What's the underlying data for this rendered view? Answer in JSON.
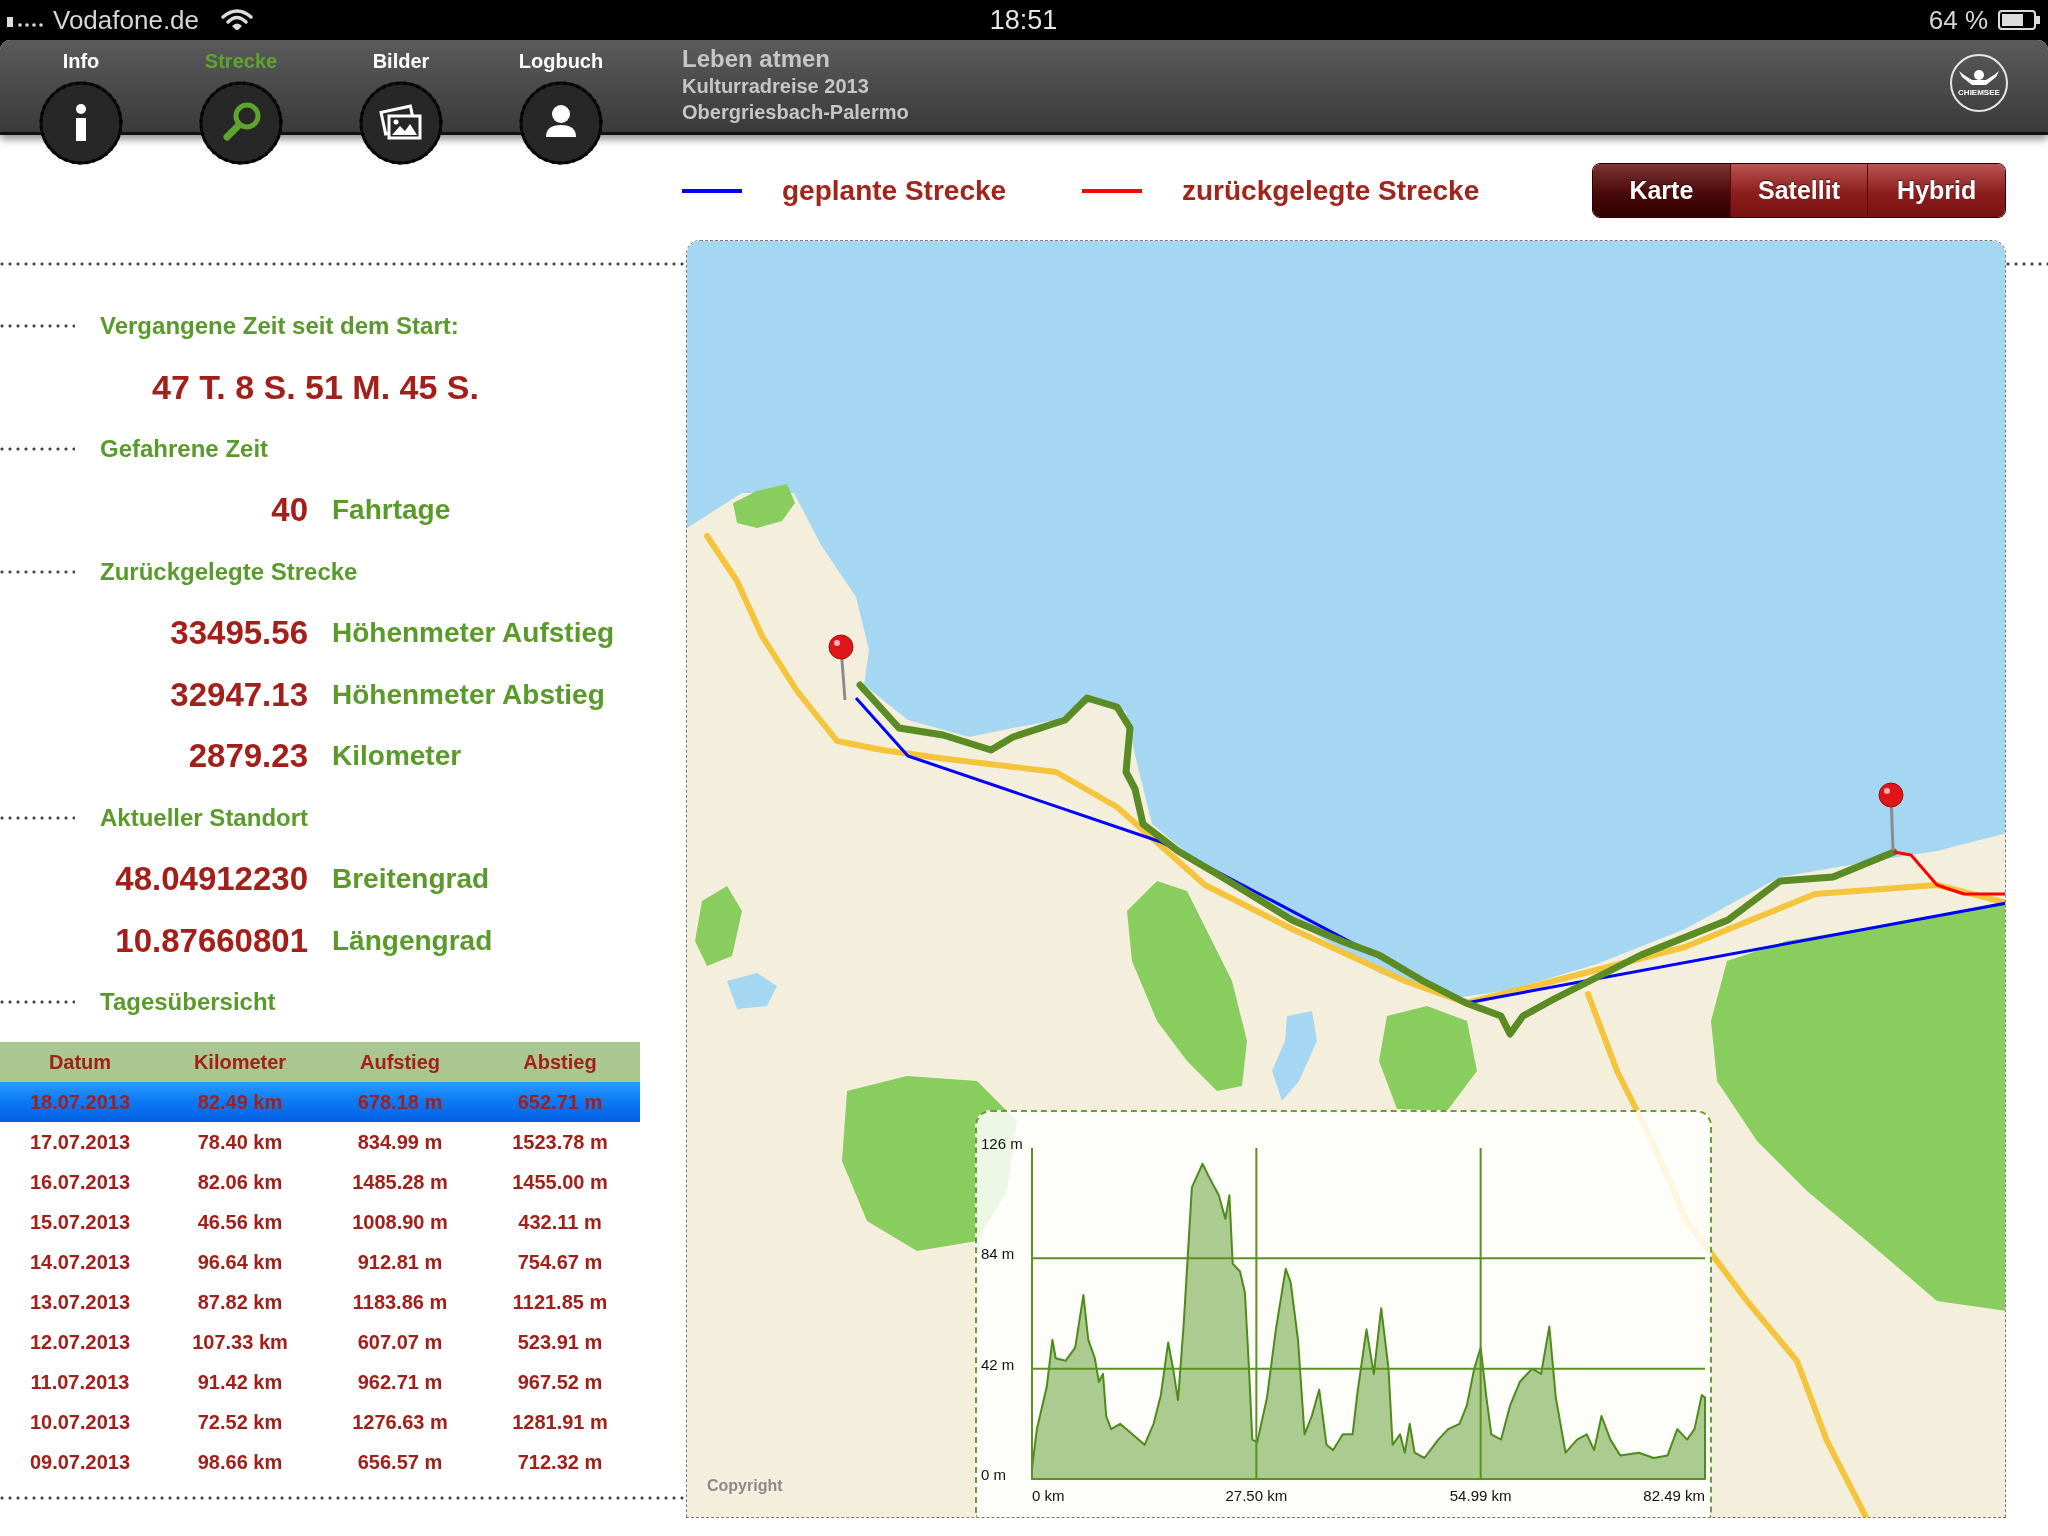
{
  "status_bar": {
    "carrier": "Vodafone.de",
    "time": "18:51",
    "battery": "64 %"
  },
  "tabs": [
    {
      "label": "Info",
      "selected": false
    },
    {
      "label": "Strecke",
      "selected": true
    },
    {
      "label": "Bilder",
      "selected": false
    },
    {
      "label": "Logbuch",
      "selected": false
    }
  ],
  "header": {
    "title": "Leben atmen",
    "subtitle": "Kulturradreise 2013",
    "route": "Obergriesbach-Palermo",
    "logo_text": "CHIEMSEE"
  },
  "legend": [
    {
      "label": "geplante Strecke",
      "color": "#0000ff"
    },
    {
      "label": "zurückgelegte Strecke",
      "color": "#ff0000"
    }
  ],
  "map_types": [
    {
      "label": "Karte",
      "selected": true
    },
    {
      "label": "Satellit",
      "selected": false
    },
    {
      "label": "Hybrid",
      "selected": false
    }
  ],
  "stats": [
    {
      "title": "Vergangene Zeit seit dem Start:",
      "rows": [
        {
          "kind": "text",
          "value": "47 T. 8 S. 51 M. 45 S."
        }
      ]
    },
    {
      "title": "Gefahrene Zeit",
      "rows": [
        {
          "kind": "pair",
          "value": "40",
          "label": "Fahrtage"
        }
      ]
    },
    {
      "title": "Zurückgelegte Strecke",
      "rows": [
        {
          "kind": "pair",
          "value": "33495.56",
          "label": "Höhenmeter Aufstieg"
        },
        {
          "kind": "pair",
          "value": "32947.13",
          "label": "Höhenmeter Abstieg"
        },
        {
          "kind": "pair",
          "value": "2879.23",
          "label": "Kilometer"
        }
      ]
    },
    {
      "title": "Aktueller Standort",
      "rows": [
        {
          "kind": "pair",
          "value": "48.04912230",
          "label": "Breitengrad"
        },
        {
          "kind": "pair",
          "value": "10.87660801",
          "label": "Längengrad"
        }
      ]
    },
    {
      "title": "Tagesübersicht"
    }
  ],
  "day_table": {
    "columns": [
      "Datum",
      "Kilometer",
      "Aufstieg",
      "Abstieg"
    ],
    "rows": [
      {
        "selected": true,
        "cells": [
          "18.07.2013",
          "82.49 km",
          "678.18 m",
          "652.71 m"
        ]
      },
      {
        "selected": false,
        "cells": [
          "17.07.2013",
          "78.40 km",
          "834.99 m",
          "1523.78 m"
        ]
      },
      {
        "selected": false,
        "cells": [
          "16.07.2013",
          "82.06 km",
          "1485.28 m",
          "1455.00 m"
        ]
      },
      {
        "selected": false,
        "cells": [
          "15.07.2013",
          "46.56 km",
          "1008.90 m",
          "432.11 m"
        ]
      },
      {
        "selected": false,
        "cells": [
          "14.07.2013",
          "96.64 km",
          "912.81 m",
          "754.67 m"
        ]
      },
      {
        "selected": false,
        "cells": [
          "13.07.2013",
          "87.82 km",
          "1183.86 m",
          "1121.85 m"
        ]
      },
      {
        "selected": false,
        "cells": [
          "12.07.2013",
          "107.33 km",
          "607.07 m",
          "523.91 m"
        ]
      },
      {
        "selected": false,
        "cells": [
          "11.07.2013",
          "91.42 km",
          "962.71 m",
          "967.52 m"
        ]
      },
      {
        "selected": false,
        "cells": [
          "10.07.2013",
          "72.52 km",
          "1276.63 m",
          "1281.91 m"
        ]
      },
      {
        "selected": false,
        "cells": [
          "09.07.2013",
          "98.66 km",
          "656.57 m",
          "712.32 m"
        ]
      }
    ]
  },
  "map": {
    "elevation_chart": {
      "chart_data": {
        "type": "area",
        "x": [
          0,
          0.6,
          1.8,
          2.5,
          2.9,
          4.1,
          5.3,
          6.3,
          6.9,
          7.7,
          8.2,
          8.7,
          9.1,
          9.7,
          10.8,
          12.3,
          13.8,
          14.9,
          15.8,
          16.7,
          17.3,
          17.9,
          18.6,
          19.6,
          20.9,
          21.7,
          22.9,
          23.7,
          24.2,
          24.6,
          25.5,
          26.1,
          26.6,
          27.0,
          27.6,
          28.8,
          29.9,
          31.1,
          31.7,
          32.6,
          33.4,
          34.3,
          35.2,
          36.1,
          36.9,
          38.1,
          39.3,
          39.9,
          41.0,
          41.9,
          42.8,
          43.7,
          44.2,
          45.1,
          45.7,
          46.3,
          46.9,
          48.1,
          49.8,
          51.0,
          52.4,
          53.3,
          54.2,
          55.0,
          55.7,
          56.3,
          57.5,
          58.6,
          59.8,
          61.3,
          62.4,
          63.4,
          64.2,
          65.4,
          66.8,
          68.0,
          68.9,
          69.8,
          70.9,
          72.1,
          74.4,
          76.2,
          77.9,
          79.1,
          80.3,
          81.2,
          82.1,
          82.49
        ],
        "values": [
          4,
          19,
          35,
          53,
          46,
          45,
          50,
          70,
          53,
          46,
          37,
          40,
          24,
          19,
          21,
          17,
          13,
          21,
          32,
          52,
          42,
          30,
          59,
          111,
          120,
          115,
          108,
          99,
          108,
          82,
          79,
          71,
          42,
          15,
          14,
          31,
          57,
          80,
          75,
          53,
          17,
          24,
          34,
          13,
          11,
          17,
          17,
          33,
          57,
          40,
          65,
          42,
          13,
          17,
          10,
          21,
          10,
          8,
          15,
          19,
          21,
          28,
          42,
          50,
          31,
          17,
          15,
          28,
          37,
          42,
          40,
          58,
          31,
          10,
          15,
          17,
          11,
          24,
          15,
          9,
          10,
          8,
          9,
          19,
          15,
          19,
          32,
          31
        ],
        "xlim": [
          0,
          82.49
        ],
        "ylim": [
          0,
          126
        ],
        "xticks": [
          {
            "value": 0,
            "label": "0 km"
          },
          {
            "value": 27.5,
            "label": "27.50 km"
          },
          {
            "value": 54.99,
            "label": "54.99 km"
          },
          {
            "value": 82.49,
            "label": "82.49 km"
          }
        ],
        "yticks": [
          {
            "value": 126,
            "label": "126 m"
          },
          {
            "value": 84,
            "label": "84 m"
          },
          {
            "value": 42,
            "label": "42 m"
          },
          {
            "value": 0,
            "label": "0 m"
          }
        ],
        "grid": true
      }
    },
    "copyright": "Copyright"
  }
}
